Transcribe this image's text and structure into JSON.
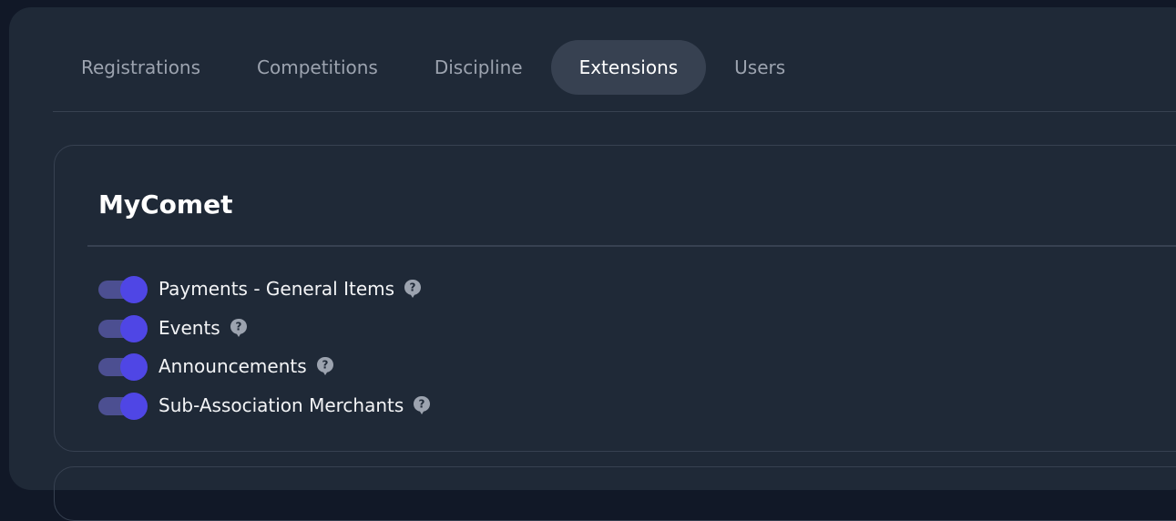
{
  "tabs": [
    {
      "label": "Registrations",
      "active": false
    },
    {
      "label": "Competitions",
      "active": false
    },
    {
      "label": "Discipline",
      "active": false
    },
    {
      "label": "Extensions",
      "active": true
    },
    {
      "label": "Users",
      "active": false
    }
  ],
  "section": {
    "title": "MyComet",
    "extensions": [
      {
        "label": "Payments - General Items",
        "enabled": true,
        "icon": "help-icon"
      },
      {
        "label": "Events",
        "enabled": true,
        "icon": "help-icon"
      },
      {
        "label": "Announcements",
        "enabled": true,
        "icon": "help-icon"
      },
      {
        "label": "Sub-Association Merchants",
        "enabled": true,
        "icon": "help-icon"
      }
    ]
  },
  "colors": {
    "background": "#111827",
    "panel": "#1f2937",
    "active_tab": "#374151",
    "toggle_on": "#4f46e5",
    "help_icon": "#9ca3af"
  }
}
